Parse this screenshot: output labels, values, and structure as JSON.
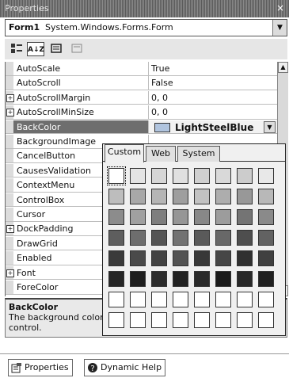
{
  "window": {
    "title": "Properties"
  },
  "object_selector": {
    "name": "Form1",
    "type": "System.Windows.Forms.Form"
  },
  "toolbar": {
    "alphabetical_label": "A↓Z"
  },
  "properties": [
    {
      "name": "AutoScale",
      "value": "True",
      "expandable": false
    },
    {
      "name": "AutoScroll",
      "value": "False",
      "expandable": false
    },
    {
      "name": "AutoScrollMargin",
      "value": "0, 0",
      "expandable": true
    },
    {
      "name": "AutoScrollMinSize",
      "value": "0, 0",
      "expandable": true
    },
    {
      "name": "BackColor",
      "value": "LightSteelBlue",
      "expandable": false,
      "selected": true
    },
    {
      "name": "BackgroundImage",
      "value": "",
      "expandable": false
    },
    {
      "name": "CancelButton",
      "value": "",
      "expandable": false
    },
    {
      "name": "CausesValidation",
      "value": "",
      "expandable": false
    },
    {
      "name": "ContextMenu",
      "value": "",
      "expandable": false
    },
    {
      "name": "ControlBox",
      "value": "",
      "expandable": false
    },
    {
      "name": "Cursor",
      "value": "",
      "expandable": false
    },
    {
      "name": "DockPadding",
      "value": "",
      "expandable": true
    },
    {
      "name": "DrawGrid",
      "value": "",
      "expandable": false
    },
    {
      "name": "Enabled",
      "value": "",
      "expandable": false
    },
    {
      "name": "Font",
      "value": "",
      "expandable": true
    },
    {
      "name": "ForeColor",
      "value": "",
      "expandable": false
    }
  ],
  "color_picker": {
    "tabs": [
      "Custom",
      "Web",
      "System"
    ],
    "active_tab": "Custom",
    "selected_color": "#b0c4de",
    "rows": [
      [
        "#ffffff",
        "#e4e4e4",
        "#d6d6d6",
        "#e0e0e0",
        "#cfcfcf",
        "#d9d9d9",
        "#cccccc",
        "#e8e8e8"
      ],
      [
        "#bdbdbd",
        "#a8a8a8",
        "#b5b5b5",
        "#9e9e9e",
        "#c2c2c2",
        "#adadad",
        "#989898",
        "#b8b8b8"
      ],
      [
        "#8c8c8c",
        "#a0a0a0",
        "#7e7e7e",
        "#969696",
        "#888888",
        "#9c9c9c",
        "#747474",
        "#8a8a8a"
      ],
      [
        "#5e5e5e",
        "#6e6e6e",
        "#545454",
        "#727272",
        "#5a5a5a",
        "#686868",
        "#4e4e4e",
        "#626262"
      ],
      [
        "#3a3a3a",
        "#4a4a4a",
        "#424242",
        "#525252",
        "#383838",
        "#464646",
        "#303030",
        "#404040"
      ],
      [
        "#262626",
        "#1e1e1e",
        "#2c2c2c",
        "#222222",
        "#2a2a2a",
        "#1a1a1a",
        "#282828",
        "#202020"
      ],
      [
        "#ffffff",
        "#ffffff",
        "#ffffff",
        "#ffffff",
        "#ffffff",
        "#ffffff",
        "#ffffff",
        "#ffffff"
      ],
      [
        "#ffffff",
        "#ffffff",
        "#ffffff",
        "#ffffff",
        "#ffffff",
        "#ffffff",
        "#ffffff",
        "#ffffff"
      ]
    ]
  },
  "description": {
    "title": "BackColor",
    "text": "The background color used to display text and graphics in the control."
  },
  "bottom_tabs": [
    {
      "label": "Properties",
      "icon": "properties-icon"
    },
    {
      "label": "Dynamic Help",
      "icon": "help-icon"
    }
  ]
}
